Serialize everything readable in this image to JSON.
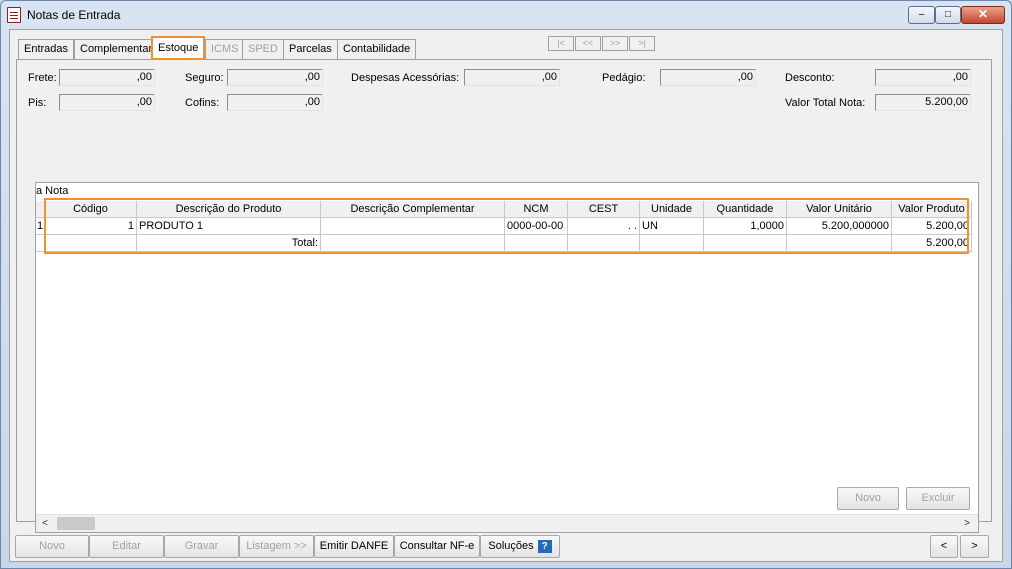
{
  "window": {
    "title": "Notas de Entrada",
    "min_icon": "–",
    "max_icon": "□",
    "close_icon": "✕"
  },
  "tabs": [
    {
      "label": "Entradas"
    },
    {
      "label": "Complementar"
    },
    {
      "label": "Estoque"
    },
    {
      "label": "ICMS"
    },
    {
      "label": "SPED"
    },
    {
      "label": "Parcelas"
    },
    {
      "label": "Contabilidade"
    }
  ],
  "record_nav": {
    "first": "|<",
    "prev": "<<",
    "next": ">>",
    "last": ">|"
  },
  "totals": {
    "frete": {
      "label": "Frete:",
      "value": ",00"
    },
    "seguro": {
      "label": "Seguro:",
      "value": ",00"
    },
    "despesas": {
      "label": "Despesas Acessórias:",
      "value": ",00"
    },
    "pedagio": {
      "label": "Pedágio:",
      "value": ",00"
    },
    "desconto": {
      "label": "Desconto:",
      "value": ",00"
    },
    "pis": {
      "label": "Pis:",
      "value": ",00"
    },
    "cofins": {
      "label": "Cofins:",
      "value": ",00"
    },
    "valor_total": {
      "label": "Valor Total Nota:",
      "value": "5.200,00"
    }
  },
  "grid": {
    "caption": "a Nota",
    "headers": [
      "Código",
      "Descrição do Produto",
      "Descrição Complementar",
      "NCM",
      "CEST",
      "Unidade",
      "Quantidade",
      "Valor Unitário",
      "Valor Produto"
    ],
    "row": {
      "row_num": "1",
      "codigo": "1",
      "descricao": "PRODUTO 1",
      "complementar": "",
      "ncm": "0000-00-00",
      "cest": ". .",
      "unidade": "UN",
      "quantidade": "1,0000",
      "valor_unitario": "5.200,000000",
      "valor_produto": "5.200,00"
    },
    "total_label": "Total:",
    "total_value": "5.200,00"
  },
  "panel_buttons": {
    "novo": "Novo",
    "excluir": "Excluir"
  },
  "bottom_buttons": {
    "novo": "Novo",
    "editar": "Editar",
    "gravar": "Gravar",
    "listagem": "Listagem >>",
    "emitir_danfe": "Emitir DANFE",
    "consultar_nfe": "Consultar NF-e",
    "solucoes": "Soluções",
    "prev": "<",
    "next": ">"
  },
  "scroll": {
    "left": "<",
    "right": ">"
  },
  "help_icon": "?"
}
